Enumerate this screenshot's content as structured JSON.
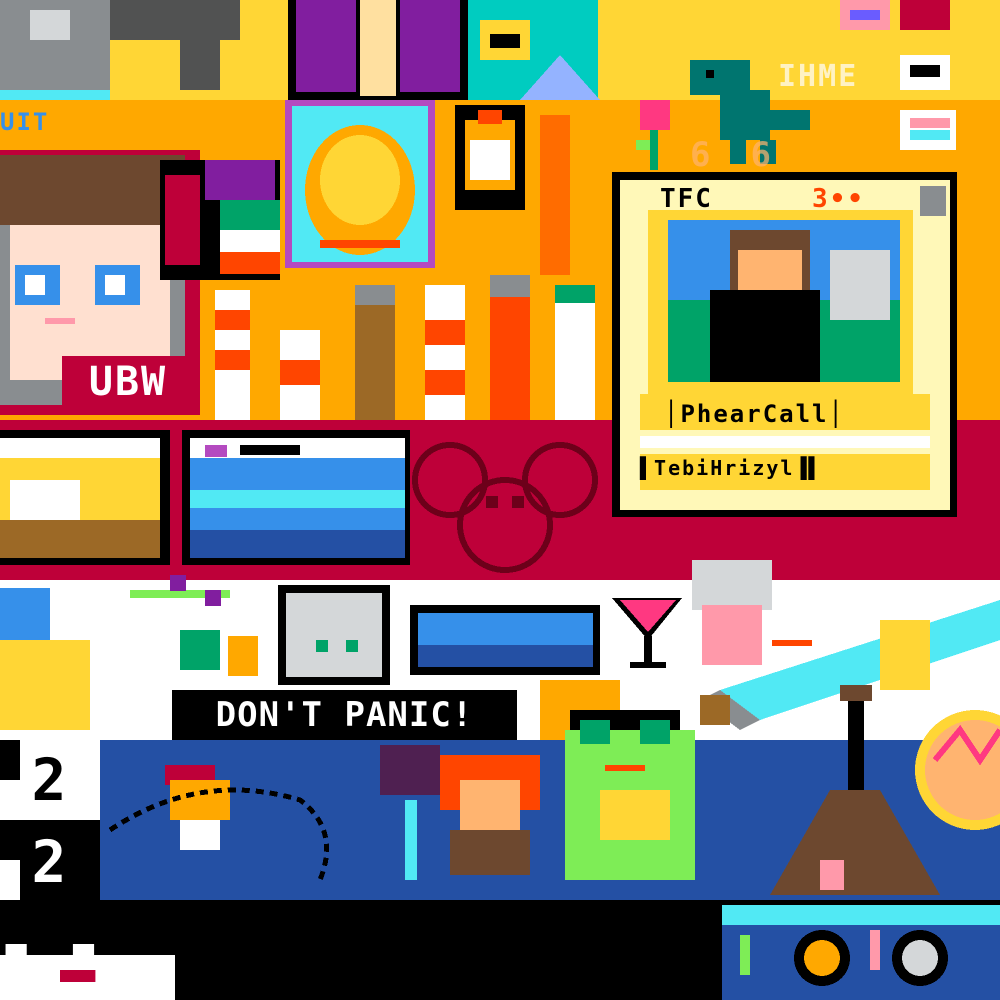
{
  "canvas": {
    "name": "pixel-art-collage",
    "palette": {
      "orange": "#ffa800",
      "yellow": "#ffd635",
      "red": "#be0039",
      "white": "#ffffff",
      "blue": "#2450a4",
      "black": "#000000",
      "green": "#00a368",
      "teal": "#00ccc0",
      "gray": "#898d90"
    }
  },
  "labels": {
    "dont_panic": "DON'T PANIC!",
    "ubw": "UBW",
    "tfc_header": "TFC",
    "tfc_sub": "3••",
    "card_name": "│PhearCall│",
    "card_footer": "▌TebiHrizyl▐▌",
    "number_top": "2",
    "number_bottom": "2",
    "faded_word": "IHME",
    "faded_numbers": "66",
    "top_tag": "UIT",
    "corner_text": "▀▄ ▀▄"
  },
  "icons": [
    "elephant-icon",
    "anime-girl-icon",
    "cat-portrait-icon",
    "penguin-icon",
    "lighthouse-icon",
    "dinosaur-icon",
    "heart-icon",
    "flower-icon",
    "trading-card-icon",
    "steve-minecraft-icon",
    "deadmau5-icon",
    "python-logo-icon",
    "cat-face-icon",
    "whale-icon",
    "cocktail-icon",
    "rat-icon",
    "sword-icon",
    "duck-icon",
    "knight-character-icon",
    "frog-icon",
    "windmill-icon",
    "pink-cat-icon",
    "panda-icon"
  ]
}
